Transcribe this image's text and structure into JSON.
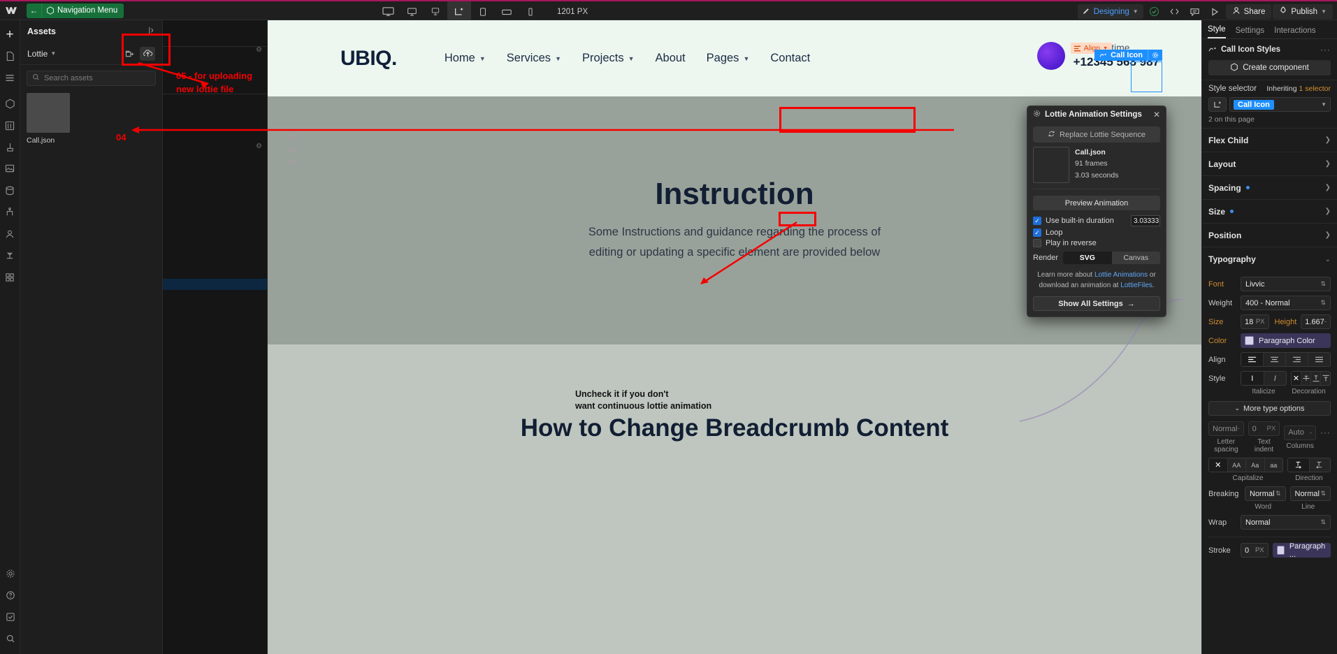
{
  "topbar": {
    "logo": "webflow-logo",
    "nav_menu_label": "Navigation Menu",
    "back_icon": "arrow-left-icon",
    "cube_icon": "component-cube-icon",
    "devices": [
      {
        "name": "desktop-xl",
        "icon": "monitor-icon"
      },
      {
        "name": "desktop-lg",
        "icon": "monitor-icon"
      },
      {
        "name": "desktop",
        "icon": "monitor-icon"
      },
      {
        "name": "base-breakpoint",
        "icon": "base-breakpoint-icon"
      },
      {
        "name": "tablet",
        "icon": "tablet-icon"
      },
      {
        "name": "mobile-landscape",
        "icon": "mobile-landscape-icon"
      },
      {
        "name": "mobile-portrait",
        "icon": "mobile-portrait-icon"
      }
    ],
    "canvas_width": "1201 PX",
    "mode_label": "Designing",
    "brush_icon": "brush-icon",
    "check_icon": "check-circle-icon",
    "code_icon": "code-brackets-icon",
    "comment_icon": "comment-icon",
    "preview_icon": "play-triangle-icon",
    "share_label": "Share",
    "publish_label": "Publish"
  },
  "rail": {
    "items": [
      {
        "name": "add-element",
        "icon": "plus-icon"
      },
      {
        "name": "pages",
        "icon": "page-icon"
      },
      {
        "name": "navigator",
        "icon": "layers-icon"
      },
      {
        "name": "components",
        "icon": "cube-icon"
      },
      {
        "name": "variables",
        "icon": "variables-icon"
      },
      {
        "name": "style-manager",
        "icon": "brush-icon"
      },
      {
        "name": "assets",
        "icon": "image-icon"
      },
      {
        "name": "cms",
        "icon": "database-icon"
      },
      {
        "name": "ecommerce",
        "icon": "node-tree-icon"
      },
      {
        "name": "users",
        "icon": "user-icon"
      },
      {
        "name": "logic",
        "icon": "logic-icon"
      },
      {
        "name": "apps",
        "icon": "grid-apps-icon"
      }
    ],
    "bottom": [
      {
        "name": "settings",
        "icon": "gear-icon"
      },
      {
        "name": "help",
        "icon": "question-icon"
      },
      {
        "name": "audit",
        "icon": "checkbox-icon"
      },
      {
        "name": "search",
        "icon": "search-icon"
      }
    ]
  },
  "assets": {
    "title": "Assets",
    "resize_icon": "resize-handle-icon",
    "collapse_icon": "collapse-panel-icon",
    "filter_label": "Lottie",
    "new_folder_icon": "new-folder-icon",
    "upload_icon": "cloud-upload-icon",
    "search_placeholder": "Search assets",
    "search_icon": "search-icon",
    "items": [
      {
        "name": "Call.json",
        "thumb": "lottie-thumb"
      }
    ]
  },
  "site": {
    "brand": "UBIQ.",
    "menu": [
      {
        "label": "Home",
        "caret": true
      },
      {
        "label": "Services",
        "caret": true
      },
      {
        "label": "Projects",
        "caret": true
      },
      {
        "label": "About",
        "caret": false
      },
      {
        "label": "Pages",
        "caret": true
      },
      {
        "label": "Contact",
        "caret": false
      }
    ],
    "call_small": "Call any time",
    "call_number": "+12345 568 987",
    "heading": "Instruction",
    "sub_line1": "Some Instructions and guidance regarding the process of",
    "sub_line2": "editing or updating a specific element are provided below",
    "heading2": "How to Change Breadcrumb Content",
    "align_badge": "Align",
    "element_tag": "Call Icon",
    "element_tag_gear": "gear-icon"
  },
  "lottie_panel": {
    "gear_icon": "gear-icon",
    "title": "Lottie Animation Settings",
    "close_icon": "close-icon",
    "replace_label": "Replace Lottie Sequence",
    "replace_icon": "refresh-icon",
    "file_name": "Call.json",
    "frames": "91 frames",
    "duration": "3.03 seconds",
    "preview_label": "Preview Animation",
    "builtin_label": "Use built-in duration",
    "builtin_checked": true,
    "duration_value": "3.03333",
    "loop_label": "Loop",
    "loop_checked": true,
    "reverse_label": "Play in reverse",
    "reverse_checked": false,
    "render_label": "Render",
    "render_options": [
      "SVG",
      "Canvas"
    ],
    "render_selected": "SVG",
    "learn_prefix": "Learn more about ",
    "learn_link1": "Lottie Animations",
    "learn_mid": " or download an animation at ",
    "learn_link2": "LottieFiles",
    "learn_suffix": ".",
    "show_all_label": "Show All Settings",
    "show_all_arrow": "→"
  },
  "right_panel": {
    "tabs": [
      {
        "label": "Style",
        "active": true
      },
      {
        "label": "Settings",
        "active": false
      },
      {
        "label": "Interactions",
        "active": false
      }
    ],
    "styles_icon": "lottie-icon",
    "styles_name": "Call Icon Styles",
    "more_icon": "more-dots-icon",
    "create_component_label": "Create component",
    "create_component_icon": "cube-icon",
    "style_selector_label": "Style selector",
    "inheriting_text": "Inheriting",
    "inheriting_count": "1 selector",
    "selector_icon": "element-icon",
    "selector_chip": "Call Icon",
    "selector_caret": "chevron-down-icon",
    "on_this_page": "2 on this page",
    "sections": [
      {
        "label": "Flex Child",
        "dot": false
      },
      {
        "label": "Layout",
        "dot": false
      },
      {
        "label": "Spacing",
        "dot": true
      },
      {
        "label": "Size",
        "dot": true
      },
      {
        "label": "Position",
        "dot": false
      }
    ],
    "typography": {
      "title": "Typography",
      "font_label": "Font",
      "font_value": "Livvic",
      "weight_label": "Weight",
      "weight_value": "400 - Normal",
      "size_label": "Size",
      "size_value": "18",
      "size_unit": "PX",
      "height_label": "Height",
      "height_value": "1.667",
      "height_unit": "-",
      "color_label": "Color",
      "color_value": "Paragraph Color",
      "align_label": "Align",
      "align_options": [
        "align-left",
        "align-center",
        "align-right",
        "align-justify"
      ],
      "align_selected": 0,
      "style_label": "Style",
      "italic_options": [
        "I",
        "I"
      ],
      "italic_selected": 0,
      "decoration_options": [
        "×",
        "strikethrough",
        "underline",
        "overline"
      ],
      "decoration_selected": 0,
      "italicize_caption": "Italicize",
      "decoration_caption": "Decoration",
      "more_type_options": "More type options",
      "letter_spacing_value": "Normal",
      "letter_spacing_unit": "-",
      "letter_spacing_caption": "Letter spacing",
      "text_indent_value": "0",
      "text_indent_unit": "PX",
      "text_indent_caption": "Text indent",
      "columns_value": "Auto",
      "columns_unit": "-",
      "columns_caption": "Columns",
      "capitalize_options": [
        "×",
        "AA",
        "Aa",
        "aa"
      ],
      "capitalize_selected": 0,
      "capitalize_caption": "Capitalize",
      "direction_options": [
        "ltr",
        "rtl"
      ],
      "direction_selected": 0,
      "direction_caption": "Direction",
      "breaking_label": "Breaking",
      "breaking_word_value": "Normal",
      "breaking_line_value": "Normal",
      "word_caption": "Word",
      "line_caption": "Line",
      "wrap_label": "Wrap",
      "wrap_value": "Normal",
      "stroke_label": "Stroke",
      "stroke_value": "0",
      "stroke_unit": "PX",
      "stroke_color": "Paragraph ..."
    }
  },
  "annotations": {
    "note_05": "05 - for uploading\nnew lottie file",
    "note_04": "04",
    "note_uncheck_l1": "Uncheck it if you don't",
    "note_uncheck_l2": "want continuous lottie animation",
    "accent_red": "#f40000"
  }
}
